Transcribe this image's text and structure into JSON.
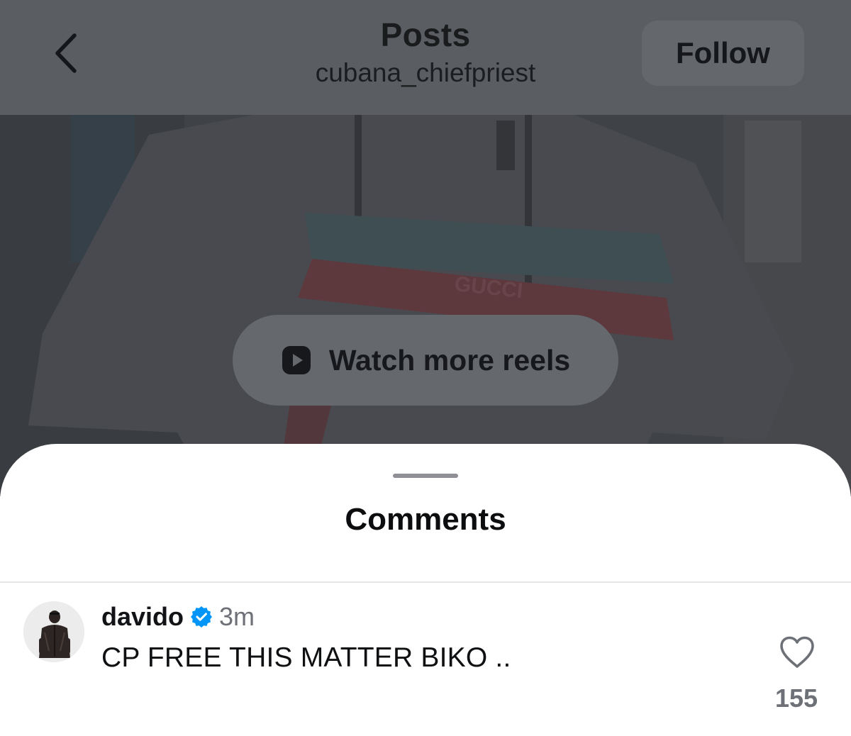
{
  "header": {
    "title": "Posts",
    "username": "cubana_chiefpriest",
    "follow_label": "Follow",
    "back_icon": "chevron-left-icon"
  },
  "video": {
    "reels_button_label": "Watch more reels",
    "reels_icon": "play-square-icon"
  },
  "comments_sheet": {
    "title": "Comments",
    "comments": [
      {
        "username": "davido",
        "verified": true,
        "timestamp": "3m",
        "text": "CP FREE THIS MATTER BIKO ..",
        "like_count": "155",
        "like_icon": "heart-outline-icon"
      }
    ]
  },
  "colors": {
    "verified_badge": "#0095f6",
    "header_bg": "#5a5d62",
    "sheet_bg": "#ffffff",
    "muted_text": "#6e7077"
  }
}
